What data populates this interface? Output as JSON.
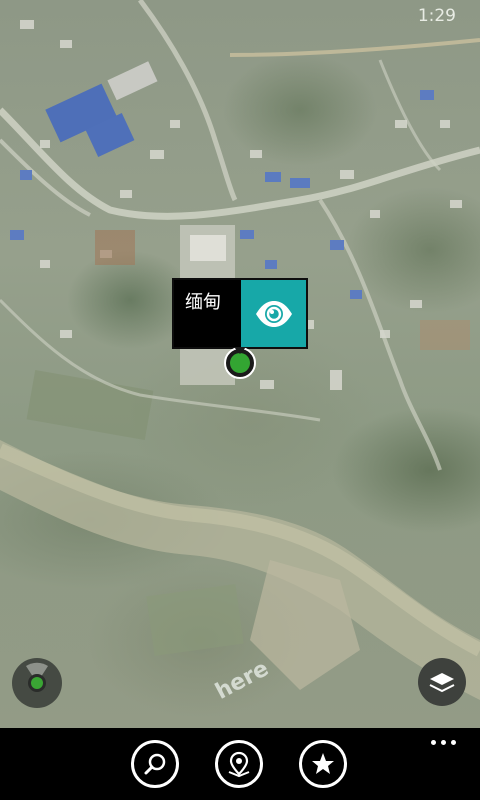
{
  "status_bar": {
    "time": "1:29"
  },
  "map": {
    "view": "satellite",
    "watermark": "here"
  },
  "location_popup": {
    "label": "缅甸",
    "action_icon": "eye-icon",
    "accent_color": "#17a8a8"
  },
  "map_controls": {
    "compass_icon": "compass-icon",
    "layers_icon": "layers-icon"
  },
  "app_bar": {
    "buttons": [
      {
        "icon": "search-icon"
      },
      {
        "icon": "location-pin-icon"
      },
      {
        "icon": "star-icon"
      }
    ],
    "more_icon": "more-dots-icon"
  }
}
